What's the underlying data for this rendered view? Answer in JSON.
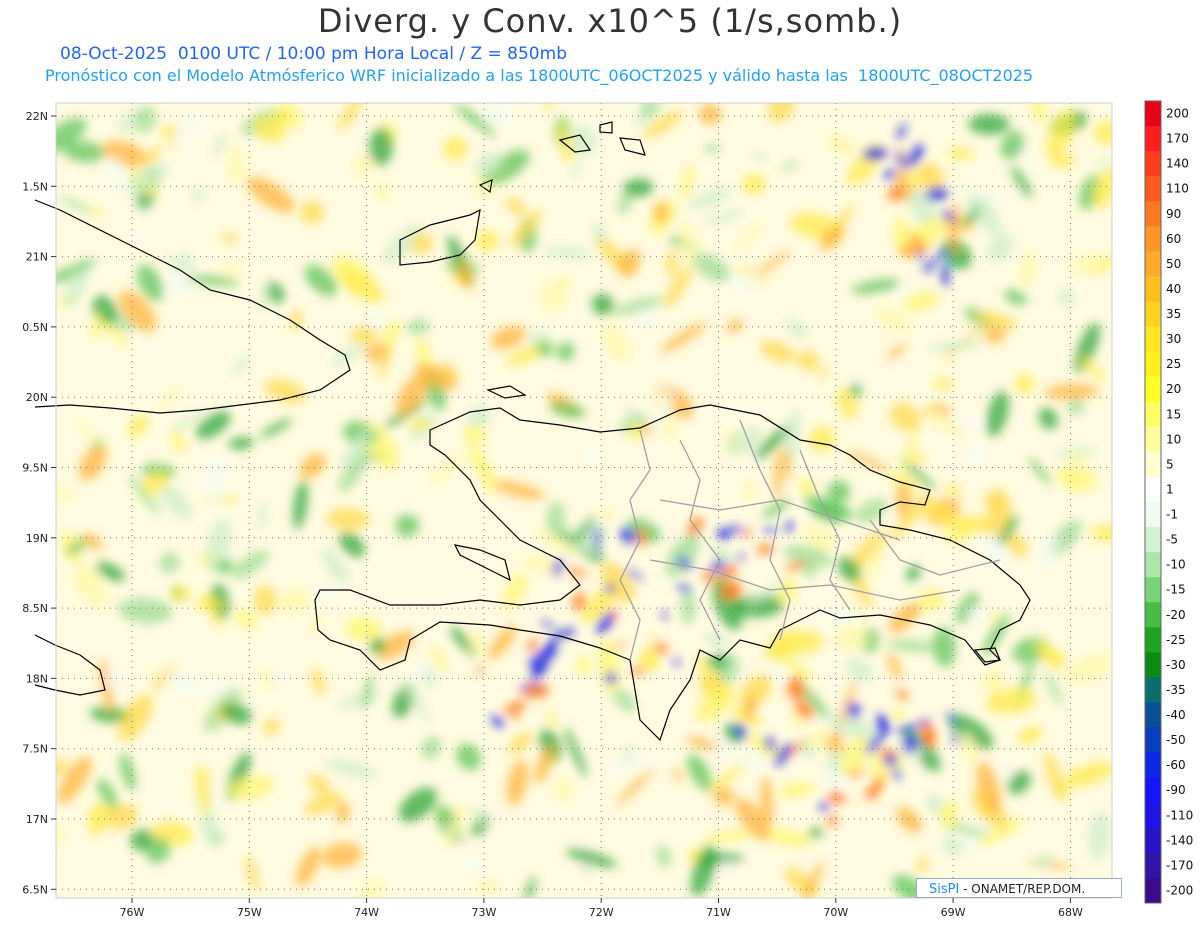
{
  "title": "Diverg. y Conv. x10^5 (1/s,somb.)",
  "subtitle_1": "08-Oct-2025  0100 UTC / 10:00 pm Hora Local / Z = 850mb",
  "subtitle_2": "Pronóstico con el Modelo Atmósferico WRF inicializado a las 1800UTC_06OCT2025 y válido hasta las  1800UTC_08OCT2025",
  "credit": {
    "brand": "SisPI",
    "rest": " - ONAMET/REP.DOM."
  },
  "lat_labels": [
    "22N",
    "1.5N",
    "21N",
    "0.5N",
    "20N",
    "9.5N",
    "19N",
    "8.5N",
    "18N",
    "7.5N",
    "17N",
    "6.5N"
  ],
  "lon_labels": [
    "76W",
    "75W",
    "74W",
    "73W",
    "72W",
    "71W",
    "70W",
    "69W",
    "68W"
  ],
  "colorbar": [
    {
      "label": "200",
      "color": "#e8001a"
    },
    {
      "label": "170",
      "color": "#ff1e1e"
    },
    {
      "label": "140",
      "color": "#ff3c1e"
    },
    {
      "label": "110",
      "color": "#ff5a1e"
    },
    {
      "label": "90",
      "color": "#ff7820"
    },
    {
      "label": "60",
      "color": "#ff9626"
    },
    {
      "label": "50",
      "color": "#ffaa28"
    },
    {
      "label": "40",
      "color": "#ffbe20"
    },
    {
      "label": "35",
      "color": "#ffd21e"
    },
    {
      "label": "30",
      "color": "#ffe61e"
    },
    {
      "label": "25",
      "color": "#fff01e"
    },
    {
      "label": "20",
      "color": "#ffff28"
    },
    {
      "label": "15",
      "color": "#ffff64"
    },
    {
      "label": "10",
      "color": "#ffffa0"
    },
    {
      "label": "5",
      "color": "#ffffd2"
    },
    {
      "label": "1",
      "color": "#ffffff"
    },
    {
      "label": "-1",
      "color": "#f0fbef"
    },
    {
      "label": "-5",
      "color": "#d2f2d0"
    },
    {
      "label": "-10",
      "color": "#aae6a6"
    },
    {
      "label": "-15",
      "color": "#78d278"
    },
    {
      "label": "-20",
      "color": "#46be46"
    },
    {
      "label": "-25",
      "color": "#1ea51e"
    },
    {
      "label": "-30",
      "color": "#0a8c14"
    },
    {
      "label": "-35",
      "color": "#0a6e6e"
    },
    {
      "label": "-40",
      "color": "#0a5096"
    },
    {
      "label": "-50",
      "color": "#0a3cbe"
    },
    {
      "label": "-60",
      "color": "#0a28e6"
    },
    {
      "label": "-90",
      "color": "#1414ff"
    },
    {
      "label": "-110",
      "color": "#1e14e6"
    },
    {
      "label": "-140",
      "color": "#2814c8"
    },
    {
      "label": "-170",
      "color": "#3214aa"
    },
    {
      "label": "-200",
      "color": "#3c0a8c"
    }
  ]
}
